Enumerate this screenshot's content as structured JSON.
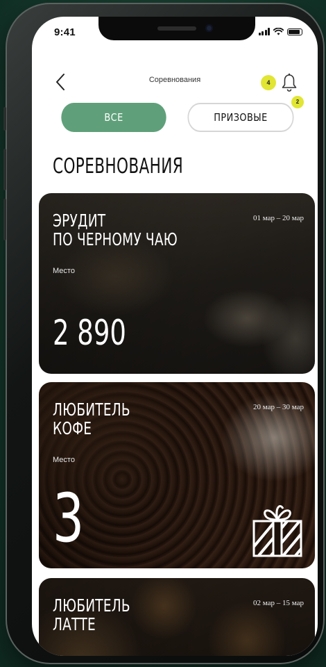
{
  "status_bar": {
    "time": "9:41"
  },
  "header": {
    "title": "Соревнования",
    "notification_count": "4"
  },
  "tabs": [
    {
      "label": "ВСЕ",
      "active": true
    },
    {
      "label": "ПРИЗОВЫЕ",
      "active": false,
      "badge": "2"
    }
  ],
  "section_title": "СОРЕВНОВАНИЯ",
  "cards": [
    {
      "title_lines": [
        "ЭРУДИТ",
        "ПО ЧЕРНОМУ ЧАЮ"
      ],
      "dates": "01 мар – 20 мар",
      "place_label": "Место",
      "place_value": "2 890",
      "prize": false
    },
    {
      "title_lines": [
        "ЛЮБИТЕЛЬ",
        "КОФЕ"
      ],
      "dates": "20 мар – 30 мар",
      "place_label": "Место",
      "place_value": "3",
      "prize": true,
      "prize_icon": "gift-icon"
    },
    {
      "title_lines": [
        "ЛЮБИТЕЛЬ",
        "ЛАТТЕ"
      ],
      "dates": "02 мар – 15 мар"
    }
  ],
  "colors": {
    "accent_green": "#5fa07a",
    "badge_yellow": "#e1e534",
    "background_green": "#163a2d"
  }
}
